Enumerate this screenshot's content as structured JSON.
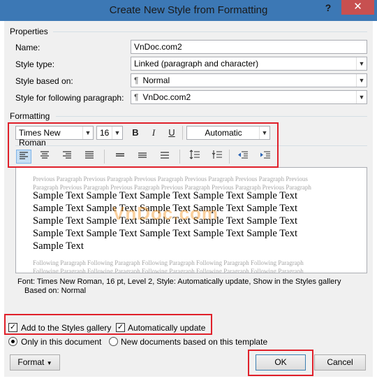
{
  "dialog": {
    "title": "Create New Style from Formatting",
    "help": "?",
    "close": "✕"
  },
  "properties": {
    "group_label": "Properties",
    "name_label": "Name:",
    "name_value": "VnDoc.com2",
    "style_type_label": "Style type:",
    "style_type_value": "Linked (paragraph and character)",
    "style_based_on_label": "Style based on:",
    "style_based_on_value": "Normal",
    "style_following_label": "Style for following paragraph:",
    "style_following_value": "VnDoc.com2"
  },
  "formatting": {
    "group_label": "Formatting",
    "font": "Times New Roman",
    "size": "16",
    "bold": "B",
    "italic": "I",
    "underline": "U",
    "color": "Automatic"
  },
  "preview": {
    "previous_paragraph": "Previous Paragraph Previous Paragraph Previous Paragraph Previous Paragraph Previous Paragraph Previous Paragraph Previous Paragraph Previous Paragraph Previous Paragraph Previous Paragraph Previous Paragraph",
    "sample_text": "Sample Text Sample Text Sample Text Sample Text Sample Text Sample Text Sample Text Sample Text Sample Text Sample Text Sample Text Sample Text Sample Text Sample Text Sample Text Sample Text Sample Text Sample Text Sample Text Sample Text Sample Text",
    "watermark": "VnDoc.com",
    "following_paragraph": "Following Paragraph Following Paragraph Following Paragraph Following Paragraph Following Paragraph Following Paragraph Following Paragraph Following Paragraph Following Paragraph Following Paragraph"
  },
  "description": {
    "line1": "Font: Times New Roman, 16 pt, Level 2, Style: Automatically update, Show in the Styles gallery",
    "line2": "Based on: Normal"
  },
  "options": {
    "add_to_gallery": "Add to the Styles gallery",
    "auto_update": "Automatically update",
    "only_this_document": "Only in this document",
    "new_documents": "New documents based on this template"
  },
  "buttons": {
    "format": "Format",
    "ok": "OK",
    "cancel": "Cancel"
  },
  "colors": {
    "highlight": "#e0202a",
    "title_bar": "#3c78b5",
    "close": "#c75050"
  }
}
